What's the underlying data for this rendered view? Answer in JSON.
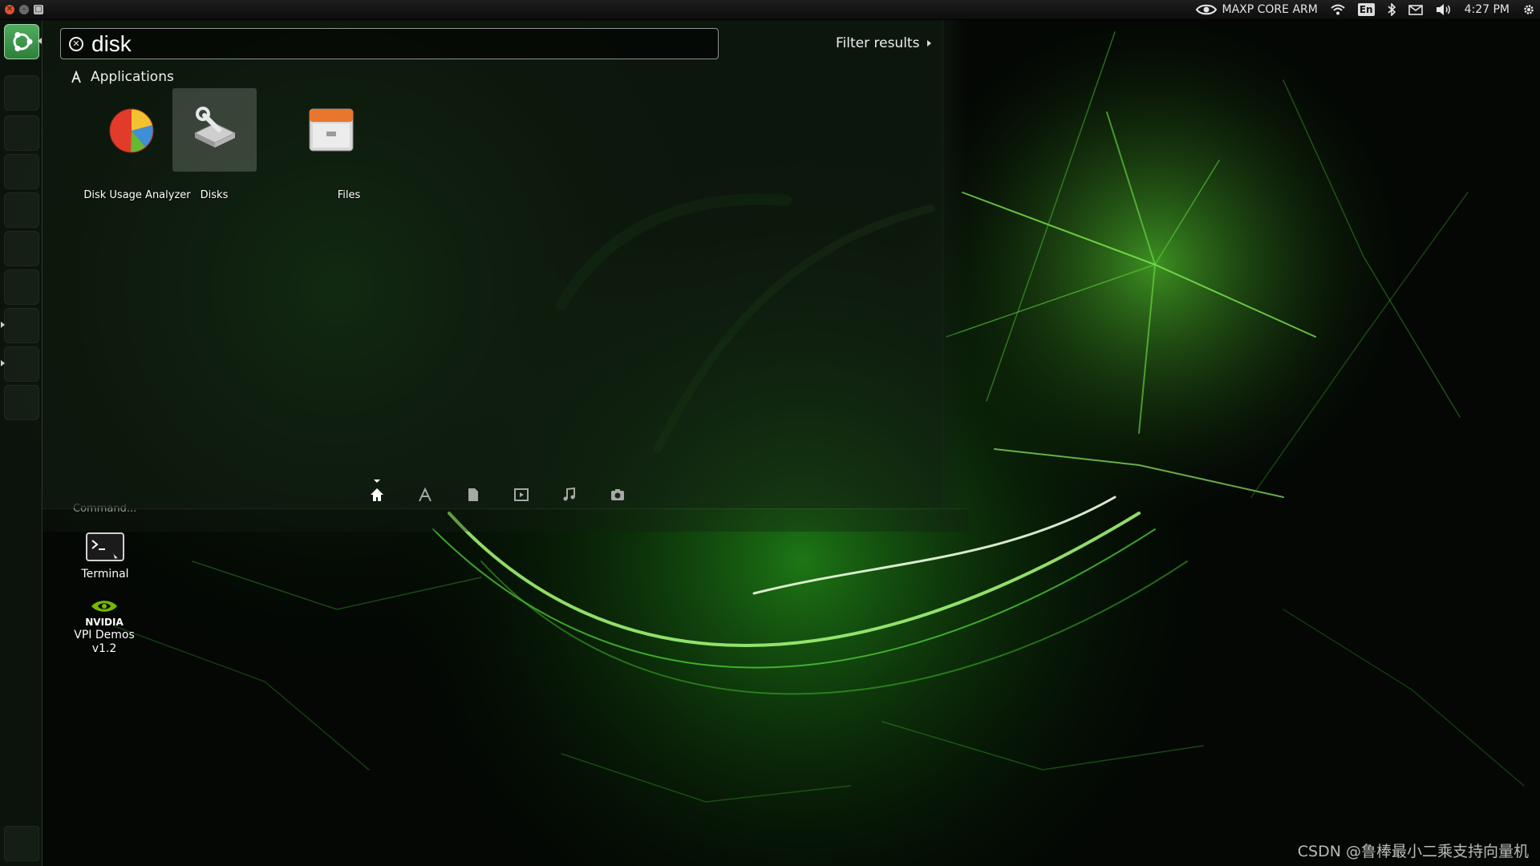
{
  "top_panel": {
    "brand_label": "MAXP CORE ARM",
    "language": "En",
    "time": "4:27 PM",
    "window_controls": [
      "close",
      "minimize",
      "maximize"
    ]
  },
  "dash": {
    "search_value": "disk",
    "filter_label": "Filter results",
    "category": "Applications",
    "results": [
      {
        "label": "Disk Usage Analyzer",
        "icon": "disk-usage-analyzer-icon",
        "selected": false
      },
      {
        "label": "Disks",
        "icon": "disks-icon",
        "selected": true
      },
      {
        "label": "Files",
        "icon": "files-icon",
        "selected": false
      }
    ],
    "lenses": [
      "home-lens-icon",
      "applications-lens-icon",
      "files-lens-icon",
      "video-lens-icon",
      "music-lens-icon",
      "photo-lens-icon"
    ],
    "faded_label": "Command..."
  },
  "desktop": {
    "terminal_label": "Terminal",
    "vpi_brand": "NVIDIA",
    "vpi_label_line1": "VPI Demos",
    "vpi_label_line2": "v1.2"
  },
  "watermark": "CSDN @鲁棒最小二乘支持向量机",
  "colors": {
    "accent": "#76b900",
    "dash_tint": "#142014",
    "launcher_active": "#3f9a4e"
  }
}
